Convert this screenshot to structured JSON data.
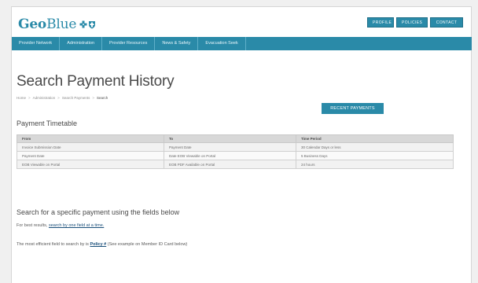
{
  "brand": {
    "name_bold": "Geo",
    "name_thin": "Blue",
    "logo_icons": [
      "cross-icon",
      "shield-icon"
    ],
    "color": "#2a8aa8"
  },
  "top_links": [
    "Profile",
    "Policies",
    "Contact Us"
  ],
  "nav": [
    "Provider Network",
    "Administration",
    "Provider Resources",
    "News & Safety",
    "Evacuation Seek"
  ],
  "page": {
    "title": "Search Payment History",
    "breadcrumb": [
      "Home",
      "Administration",
      "Search Payments",
      "Search"
    ],
    "recent_payments_label": "Recent Payments"
  },
  "timetable": {
    "title": "Payment Timetable",
    "columns": [
      "From",
      "To",
      "Time Period"
    ],
    "rows": [
      [
        "Invoice Submission Date",
        "Payment Date",
        "30 Calendar Days or less"
      ],
      [
        "Payment Date",
        "Date EOB Viewable on Portal",
        "5 Business Days"
      ],
      [
        "EOB Viewable on Portal",
        "EOB PDF Available on Portal",
        "24 hours"
      ]
    ]
  },
  "search": {
    "heading": "Search for a specific payment using the fields below",
    "best_results_prefix": "For best results,",
    "best_results_link": "search by one field at a time.",
    "efficient_prefix": "The most efficient field to search by is",
    "efficient_link": "Policy #",
    "efficient_suffix": "(See example on Member ID Card below)"
  }
}
